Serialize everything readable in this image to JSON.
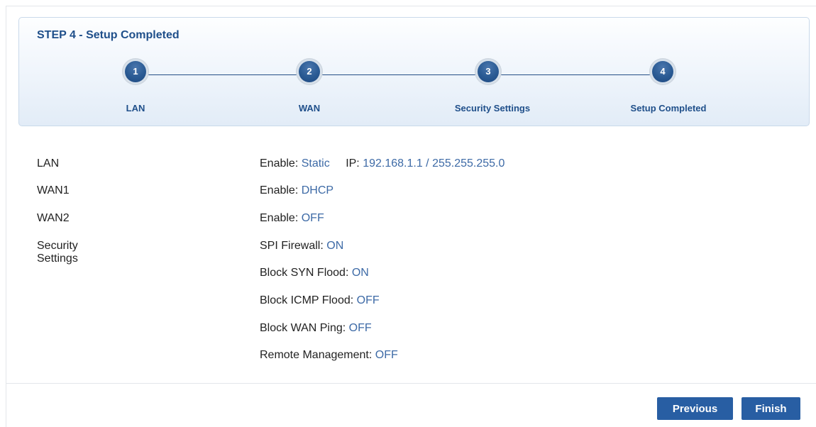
{
  "wizard": {
    "title": "STEP 4 - Setup Completed",
    "steps": [
      {
        "number": "1",
        "label": "LAN"
      },
      {
        "number": "2",
        "label": "WAN"
      },
      {
        "number": "3",
        "label": "Security Settings"
      },
      {
        "number": "4",
        "label": "Setup Completed"
      }
    ]
  },
  "summary": {
    "lan": {
      "label": "LAN",
      "enable_key": "Enable:",
      "enable_value": "Static",
      "ip_key": "IP:",
      "ip_value": "192.168.1.1 / 255.255.255.0"
    },
    "wan1": {
      "label": "WAN1",
      "enable_key": "Enable:",
      "enable_value": "DHCP"
    },
    "wan2": {
      "label": "WAN2",
      "enable_key": "Enable:",
      "enable_value": "OFF"
    },
    "security": {
      "label": "Security Settings",
      "items": [
        {
          "key": "SPI Firewall:",
          "value": "ON"
        },
        {
          "key": "Block SYN Flood:",
          "value": "ON"
        },
        {
          "key": "Block ICMP Flood:",
          "value": "OFF"
        },
        {
          "key": "Block WAN Ping:",
          "value": "OFF"
        },
        {
          "key": "Remote Management:",
          "value": "OFF"
        }
      ]
    }
  },
  "buttons": {
    "previous": "Previous",
    "finish": "Finish"
  },
  "colors": {
    "accent": "#285ea3",
    "title_text": "#1f4f8a",
    "value_text": "#3d6aa6",
    "panel_border": "#c9d9ea"
  }
}
